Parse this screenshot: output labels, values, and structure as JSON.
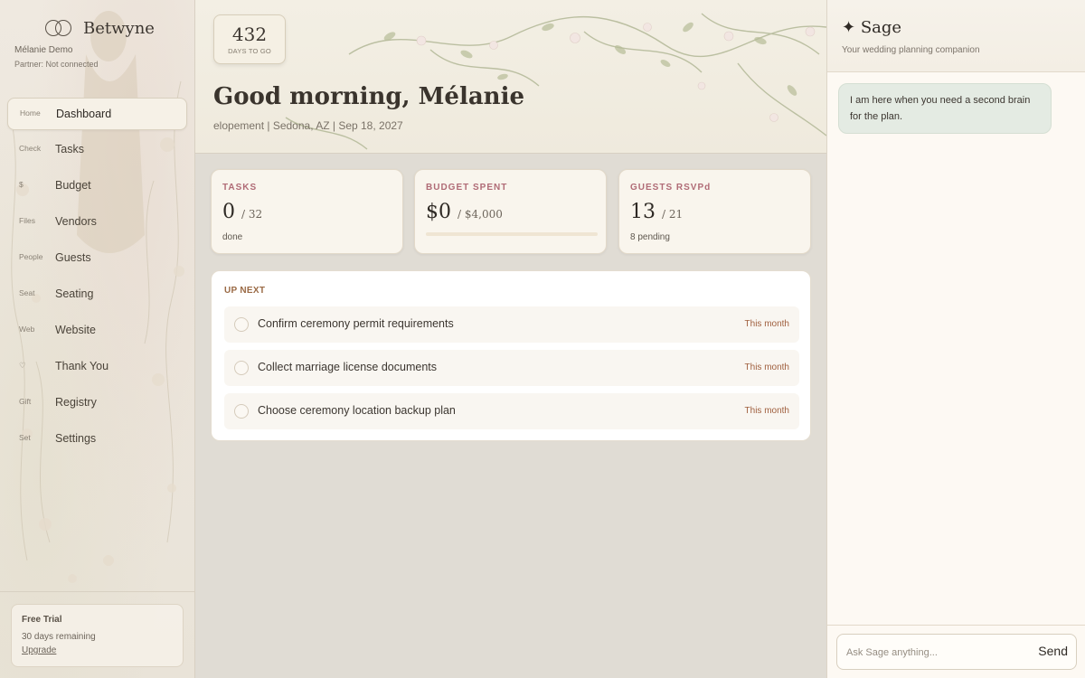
{
  "brand": {
    "name": "Betwyne",
    "icon": "wedding-rings-icon"
  },
  "user": {
    "name": "Mélanie Demo",
    "partner": "Partner: Not connected"
  },
  "nav": [
    {
      "icon": "Home",
      "label": "Dashboard",
      "active": true
    },
    {
      "icon": "Check",
      "label": "Tasks"
    },
    {
      "icon": "$",
      "label": "Budget"
    },
    {
      "icon": "Files",
      "label": "Vendors"
    },
    {
      "icon": "People",
      "label": "Guests"
    },
    {
      "icon": "Seat",
      "label": "Seating"
    },
    {
      "icon": "Web",
      "label": "Website"
    },
    {
      "icon": "♡",
      "label": "Thank You"
    },
    {
      "icon": "Gift",
      "label": "Registry"
    },
    {
      "icon": "Set",
      "label": "Settings"
    }
  ],
  "trial": {
    "title": "Free Trial",
    "days": "30 days remaining",
    "upgrade": "Upgrade"
  },
  "countdown": {
    "value": "432",
    "label": "DAYS TO GO"
  },
  "greeting": "Good morning, Mélanie",
  "event_line": "elopement | Sedona, AZ | Sep 18, 2027",
  "stats": {
    "tasks": {
      "title": "TASKS",
      "value": "0",
      "total": "/ 32",
      "foot": "done"
    },
    "budget": {
      "title": "BUDGET SPENT",
      "value": "$0",
      "total": "/ $4,000",
      "spent_fraction": 0
    },
    "guests": {
      "title": "GUESTS RSVPd",
      "value": "13",
      "total": "/ 21",
      "foot": "8 pending"
    }
  },
  "up_next": {
    "title": "UP NEXT",
    "items": [
      {
        "label": "Confirm ceremony permit requirements",
        "when": "This month"
      },
      {
        "label": "Collect marriage license documents",
        "when": "This month"
      },
      {
        "label": "Choose ceremony location backup plan",
        "when": "This month"
      }
    ]
  },
  "assistant": {
    "spark": "✦",
    "title": "Sage",
    "subtitle": "Your wedding planning companion",
    "message": "I am here when you need a second brain for the plan.",
    "placeholder": "Ask Sage anything...",
    "send_label": "Send"
  },
  "colors": {
    "accent_rose": "#b06b76",
    "accent_amber": "#9a6a45",
    "chat_bubble": "#e4ebe3",
    "sidebar_bg": "#ece6dc"
  }
}
